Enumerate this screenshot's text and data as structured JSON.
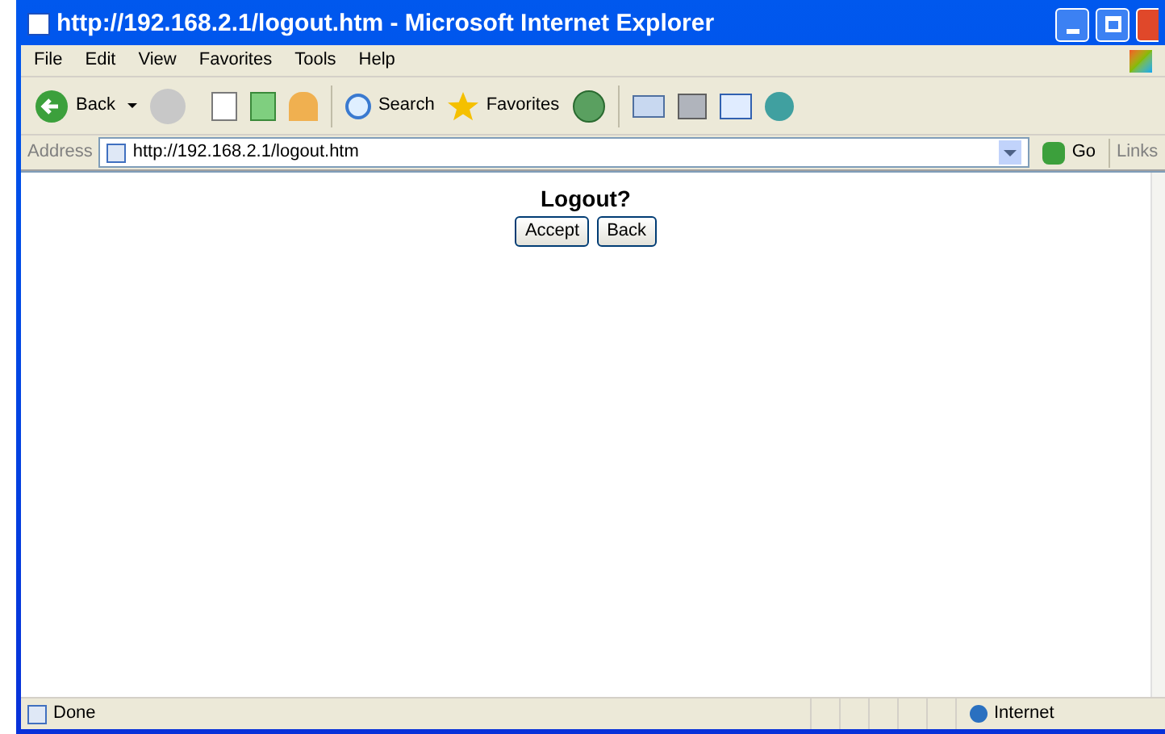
{
  "window": {
    "title": "http://192.168.2.1/logout.htm - Microsoft Internet Explorer"
  },
  "menu": [
    "File",
    "Edit",
    "View",
    "Favorites",
    "Tools",
    "Help"
  ],
  "toolbar": {
    "back": "Back",
    "search": "Search",
    "favorites": "Favorites"
  },
  "address_bar": {
    "label": "Address",
    "value": "http://192.168.2.1/logout.htm",
    "go": "Go",
    "links": "Links"
  },
  "page": {
    "heading": "Logout?",
    "buttons": [
      "Accept",
      "Back"
    ]
  },
  "status_bar": {
    "text": "Done",
    "zone": "Internet"
  }
}
